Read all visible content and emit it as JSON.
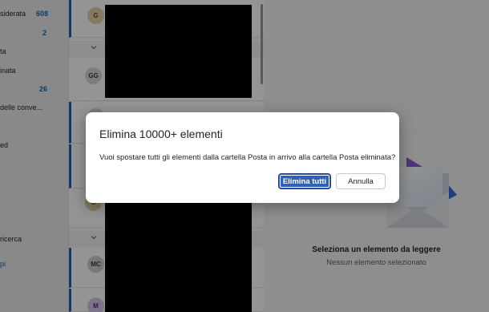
{
  "folders": [
    {
      "label": "siderata",
      "count": "608"
    },
    {
      "label": "",
      "count": "2"
    },
    {
      "label": "ta",
      "count": ""
    },
    {
      "label": "inata",
      "count": ""
    },
    {
      "label": "",
      "count": "26"
    },
    {
      "label": "delle conve...",
      "count": ""
    },
    {
      "label": "ed",
      "count": ""
    },
    {
      "label": "ricerca",
      "count": ""
    },
    {
      "label": "pi",
      "count": ""
    }
  ],
  "messages": [
    {
      "initials": "G"
    },
    {
      "initials": "GG"
    },
    {
      "initials": "A"
    },
    {
      "initials": "G"
    },
    {
      "initials": "MC"
    },
    {
      "initials": "M"
    }
  ],
  "reading_pane": {
    "title": "Seleziona un elemento da leggere",
    "subtitle": "Nessun elemento selezionato"
  },
  "dialog": {
    "title": "Elimina 10000+ elementi",
    "body": "Vuoi spostare tutti gli elementi dalla cartella Posta in arrivo alla cartella Posta eliminata?",
    "confirm_label": "Elimina tutti",
    "cancel_label": "Annulla"
  },
  "colors": {
    "accent": "#2f62b6",
    "count_blue": "#0f6cbd",
    "unread_bar": "#2b5ea8"
  },
  "icons": [
    "chevron-down-icon",
    "envelope-illustration"
  ]
}
